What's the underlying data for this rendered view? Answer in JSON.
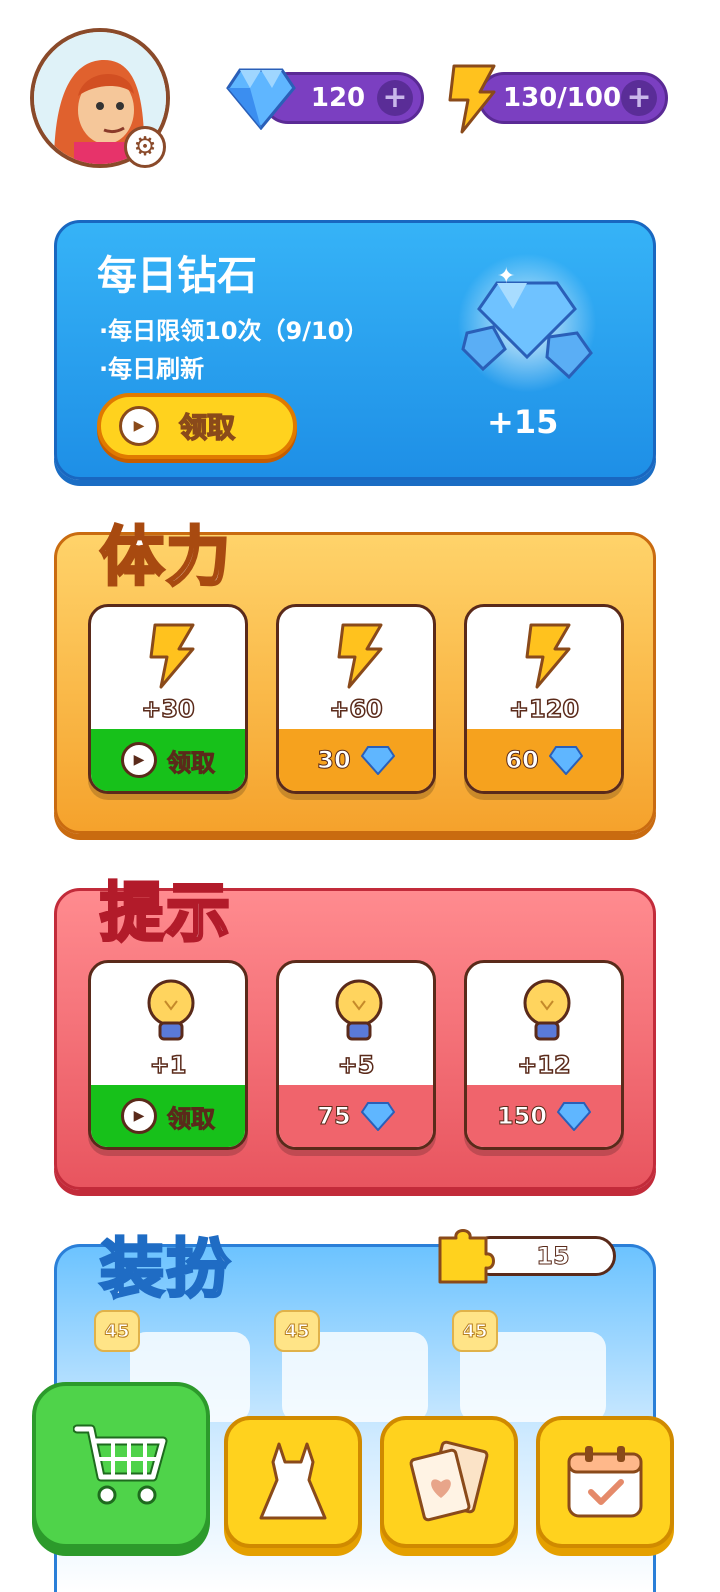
{
  "top": {
    "gems": "120",
    "energy": "130/100",
    "plus": "+"
  },
  "daily": {
    "title": "每日钻石",
    "line1": "·每日限领10次（9/10）",
    "line2": "·每日刷新",
    "button": "领取",
    "reward": "+15"
  },
  "stamina": {
    "title": "体力",
    "cards": [
      {
        "amount": "+30",
        "action": "领取"
      },
      {
        "amount": "+60",
        "price": "30"
      },
      {
        "amount": "+120",
        "price": "60"
      }
    ]
  },
  "hints": {
    "title": "提示",
    "cards": [
      {
        "amount": "+1",
        "action": "领取"
      },
      {
        "amount": "+5",
        "price": "75"
      },
      {
        "amount": "+12",
        "price": "150"
      }
    ]
  },
  "dressup": {
    "title": "装扮",
    "pieces": "15",
    "items": [
      "45",
      "45",
      "45"
    ]
  },
  "colors": {
    "purple": "#7b3fc1",
    "blue": "#2ea2f3",
    "orange": "#f6a623",
    "red": "#e8555f",
    "green": "#17c11a",
    "yellow": "#ffd21e"
  },
  "icons": [
    "gear-icon",
    "gem-icon",
    "lightning-icon",
    "plus-icon",
    "play-icon",
    "bulb-icon",
    "puzzle-icon",
    "cart-icon",
    "dress-icon",
    "card-icon",
    "calendar-icon"
  ]
}
